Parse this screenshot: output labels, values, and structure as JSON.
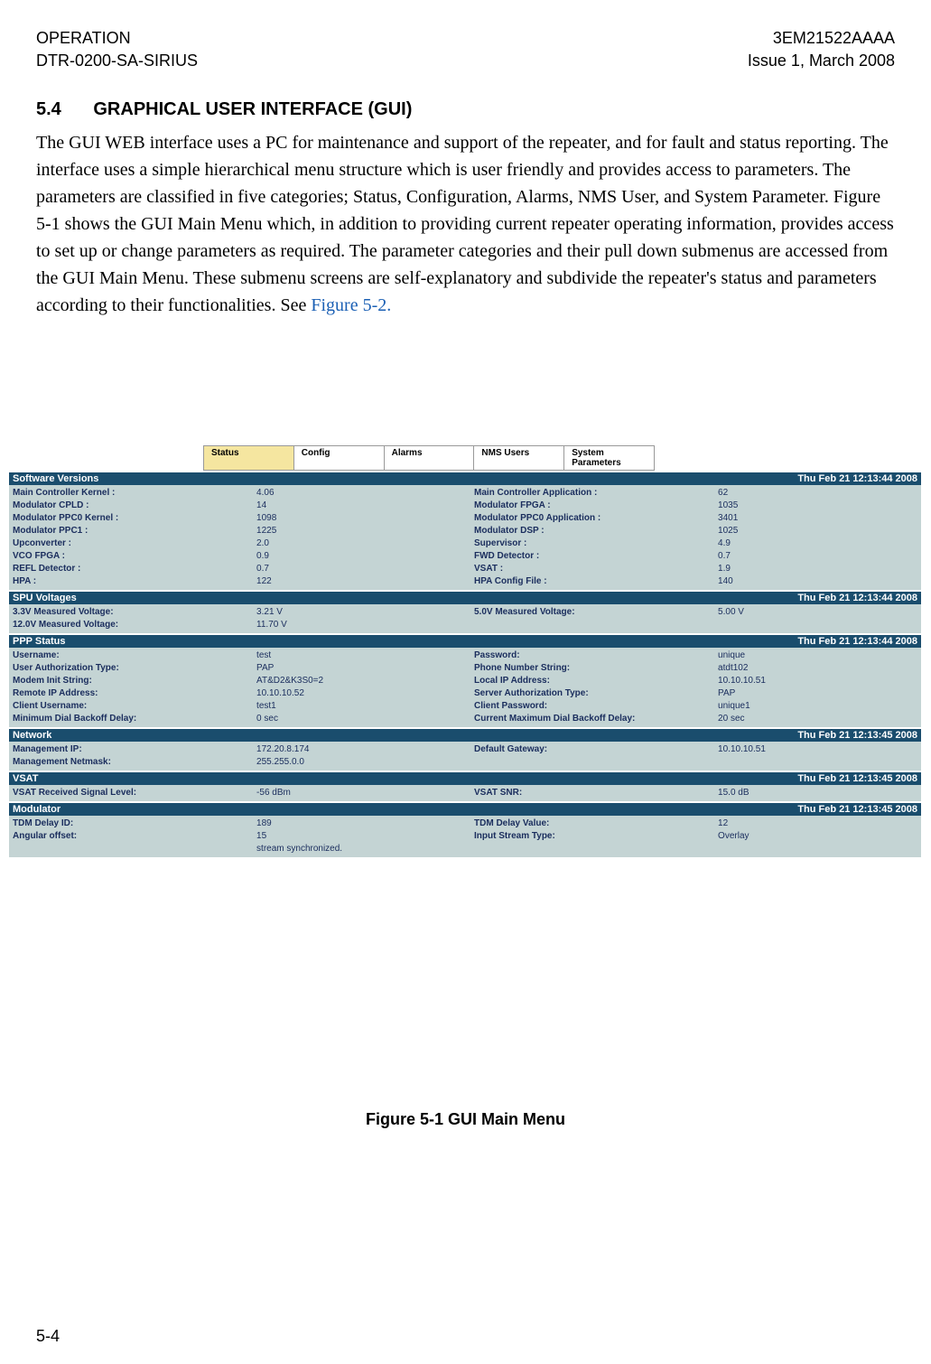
{
  "header": {
    "left_line1": "OPERATION",
    "left_line2": "DTR-0200-SA-SIRIUS",
    "right_line1": "3EM21522AAAA",
    "right_line2": "Issue 1, March 2008"
  },
  "section": {
    "number": "5.4",
    "title": "GRAPHICAL USER INTERFACE (GUI)"
  },
  "paragraph": "The GUI WEB interface uses a PC for maintenance and support of the repeater, and for fault and status reporting. The interface uses a simple hierarchical menu structure which is user friendly and provides access to parameters. The parameters are classified in five categories; Status, Configuration, Alarms, NMS User, and System Parameter. Figure 5-1 shows the GUI Main Menu which, in addition to providing current repeater operating information, provides access to set up or change parameters as required. The parameter categories and their pull down submenus are accessed from the GUI Main Menu. These submenu screens are self-explanatory and subdivide the repeater's status and parameters according to their functionalities. See ",
  "paragraph_link": "Figure 5-2.",
  "tabs": [
    "Status",
    "Config",
    "Alarms",
    "NMS Users",
    "System Parameters"
  ],
  "panels": {
    "software_versions": {
      "title": "Software Versions",
      "timestamp": "Thu Feb 21 12:13:44 2008",
      "left": [
        {
          "label": "Main Controller Kernel :",
          "value": "4.06"
        },
        {
          "label": "Modulator CPLD :",
          "value": "14"
        },
        {
          "label": "Modulator PPC0 Kernel :",
          "value": "1098"
        },
        {
          "label": "Modulator PPC1 :",
          "value": "1225"
        },
        {
          "label": "Upconverter :",
          "value": "2.0"
        },
        {
          "label": "VCO FPGA :",
          "value": "0.9"
        },
        {
          "label": "REFL Detector :",
          "value": "0.7"
        },
        {
          "label": "HPA :",
          "value": "122"
        }
      ],
      "right": [
        {
          "label": "Main Controller Application :",
          "value": "62"
        },
        {
          "label": "Modulator FPGA :",
          "value": "1035"
        },
        {
          "label": "Modulator PPC0 Application :",
          "value": "3401"
        },
        {
          "label": "Modulator DSP :",
          "value": "1025"
        },
        {
          "label": "Supervisor :",
          "value": "4.9"
        },
        {
          "label": "FWD Detector :",
          "value": "0.7"
        },
        {
          "label": "VSAT :",
          "value": "1.9"
        },
        {
          "label": "HPA Config File :",
          "value": "140"
        }
      ]
    },
    "spu_voltages": {
      "title": "SPU Voltages",
      "timestamp": "Thu Feb 21 12:13:44 2008",
      "left": [
        {
          "label": "3.3V Measured Voltage:",
          "value": "3.21 V"
        },
        {
          "label": "12.0V Measured Voltage:",
          "value": "11.70 V"
        }
      ],
      "right": [
        {
          "label": "5.0V Measured Voltage:",
          "value": "5.00 V"
        }
      ]
    },
    "ppp_status": {
      "title": "PPP Status",
      "timestamp": "Thu Feb 21 12:13:44 2008",
      "left": [
        {
          "label": "Username:",
          "value": "test"
        },
        {
          "label": "User Authorization Type:",
          "value": "PAP"
        },
        {
          "label": "Modem Init String:",
          "value": "AT&D2&K3S0=2"
        },
        {
          "label": "Remote IP Address:",
          "value": "10.10.10.52"
        },
        {
          "label": "Client Username:",
          "value": "test1"
        },
        {
          "label": "Minimum Dial Backoff Delay:",
          "value": "0 sec"
        }
      ],
      "right": [
        {
          "label": "Password:",
          "value": "unique"
        },
        {
          "label": "Phone Number String:",
          "value": "atdt102"
        },
        {
          "label": "Local IP Address:",
          "value": "10.10.10.51"
        },
        {
          "label": "Server Authorization Type:",
          "value": "PAP"
        },
        {
          "label": "Client Password:",
          "value": "unique1"
        },
        {
          "label": "Current Maximum Dial Backoff Delay:",
          "value": "20 sec"
        }
      ]
    },
    "network": {
      "title": "Network",
      "timestamp": "Thu Feb 21 12:13:45 2008",
      "left": [
        {
          "label": "Management IP:",
          "value": "172.20.8.174"
        },
        {
          "label": "Management Netmask:",
          "value": "255.255.0.0"
        }
      ],
      "right": [
        {
          "label": "Default Gateway:",
          "value": "10.10.10.51"
        }
      ]
    },
    "vsat": {
      "title": "VSAT",
      "timestamp": "Thu Feb 21 12:13:45 2008",
      "left": [
        {
          "label": "VSAT Received Signal Level:",
          "value": "-56 dBm"
        }
      ],
      "right": [
        {
          "label": "VSAT SNR:",
          "value": "15.0 dB"
        }
      ]
    },
    "modulator": {
      "title": "Modulator",
      "timestamp": "Thu Feb 21 12:13:45 2008",
      "left": [
        {
          "label": "TDM Delay ID:",
          "value": "189"
        },
        {
          "label": "Angular offset:",
          "value": "15"
        },
        {
          "label": "",
          "value": "stream synchronized."
        }
      ],
      "right": [
        {
          "label": "TDM Delay Value:",
          "value": "12"
        },
        {
          "label": "Input Stream Type:",
          "value": "Overlay"
        }
      ]
    }
  },
  "figure_caption": "Figure 5-1  GUI Main Menu",
  "page_number": "5-4"
}
